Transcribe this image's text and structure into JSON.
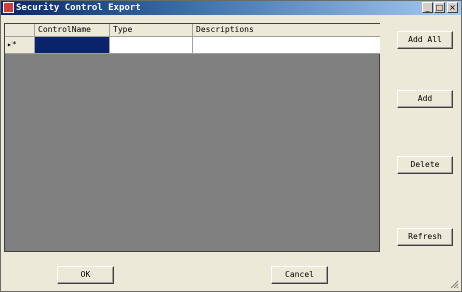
{
  "window": {
    "title": "Security Control Export",
    "controls": {
      "minimize": "_",
      "maximize": "□",
      "close": "×"
    }
  },
  "grid": {
    "columns": [
      "ControlName",
      "Type",
      "Descriptions"
    ],
    "rows": [
      {
        "indicator": "▸*",
        "cells": [
          "",
          "",
          ""
        ],
        "selected_column": 0
      }
    ],
    "colors": {
      "background": "#808080",
      "selected_cell": "#0a246a"
    }
  },
  "buttons": {
    "add_all": "Add All",
    "add": "Add",
    "delete": "Delete",
    "refresh": "Refresh",
    "ok": "OK",
    "cancel": "Cancel"
  }
}
